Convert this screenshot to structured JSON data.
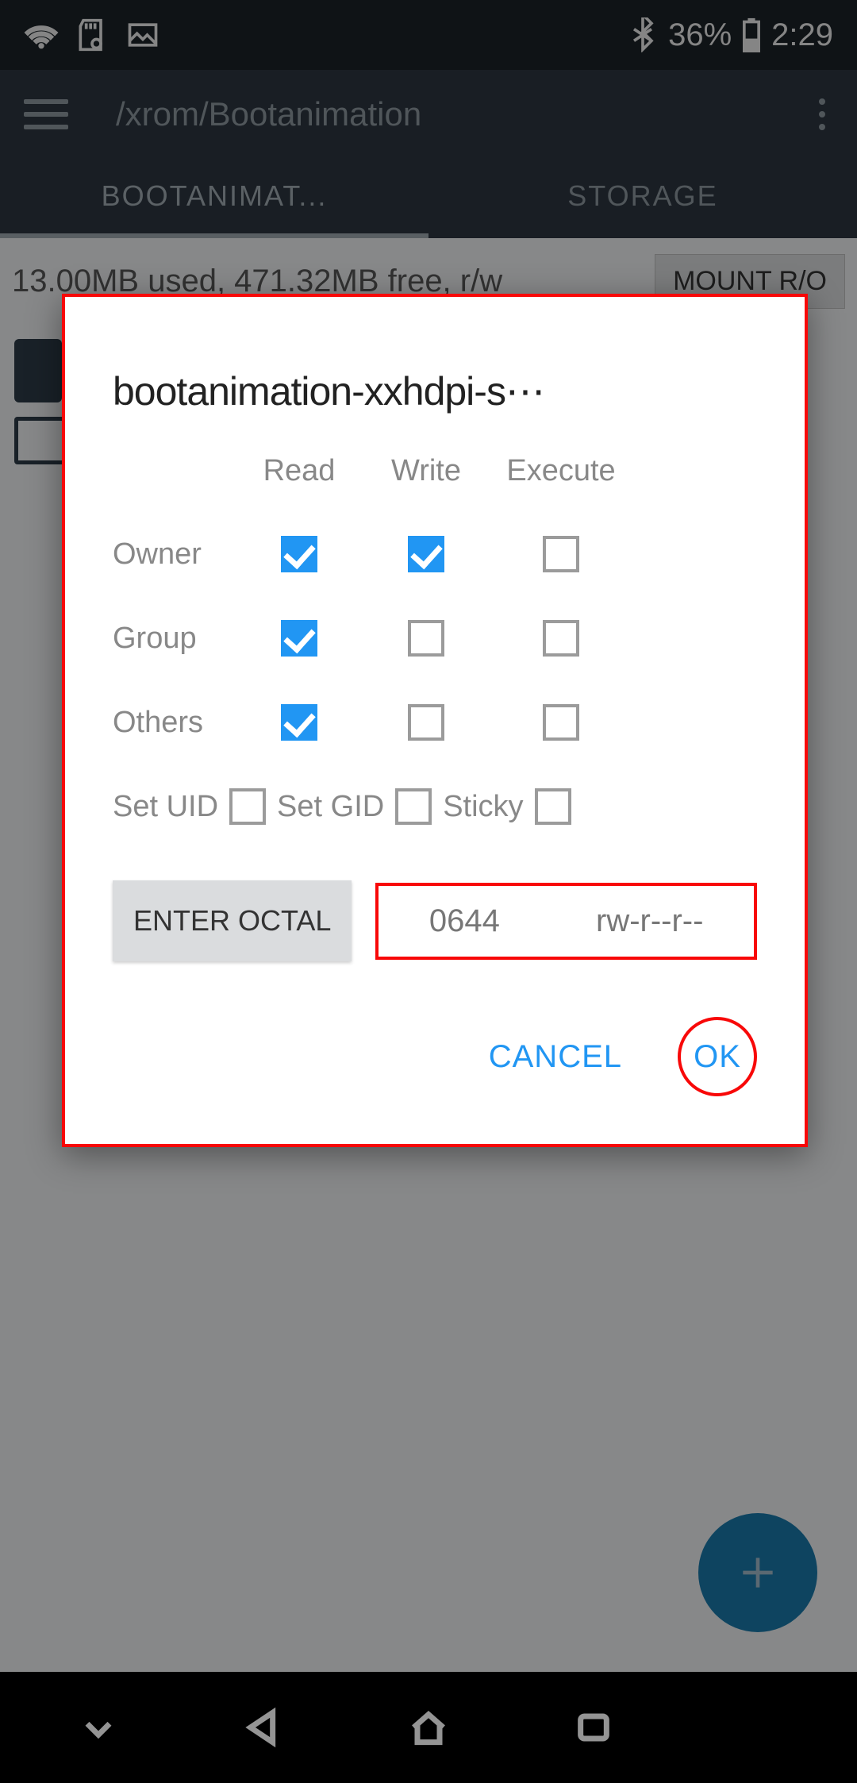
{
  "status": {
    "battery": "36%",
    "time": "2:29"
  },
  "appbar": {
    "title": "/xrom/Bootanimation"
  },
  "tabs": {
    "left": "BOOTANIMAT...",
    "right": "STORAGE"
  },
  "storage": {
    "text": "13.00MB used, 471.32MB free, r/w",
    "mount": "MOUNT R/O"
  },
  "dialog": {
    "title": "bootanimation-xxhdpi-s⋯",
    "headers": {
      "read": "Read",
      "write": "Write",
      "execute": "Execute"
    },
    "rows": {
      "owner": "Owner",
      "group": "Group",
      "others": "Others"
    },
    "perms": {
      "owner": {
        "read": true,
        "write": true,
        "execute": false
      },
      "group": {
        "read": true,
        "write": false,
        "execute": false
      },
      "others": {
        "read": true,
        "write": false,
        "execute": false
      }
    },
    "special": {
      "set_uid_label": "Set UID",
      "set_uid": false,
      "set_gid_label": "Set GID",
      "set_gid": false,
      "sticky_label": "Sticky",
      "sticky": false
    },
    "enter_octal": "ENTER OCTAL",
    "octal": "0644",
    "symbolic": "rw-r--r--",
    "cancel": "CANCEL",
    "ok": "OK"
  }
}
